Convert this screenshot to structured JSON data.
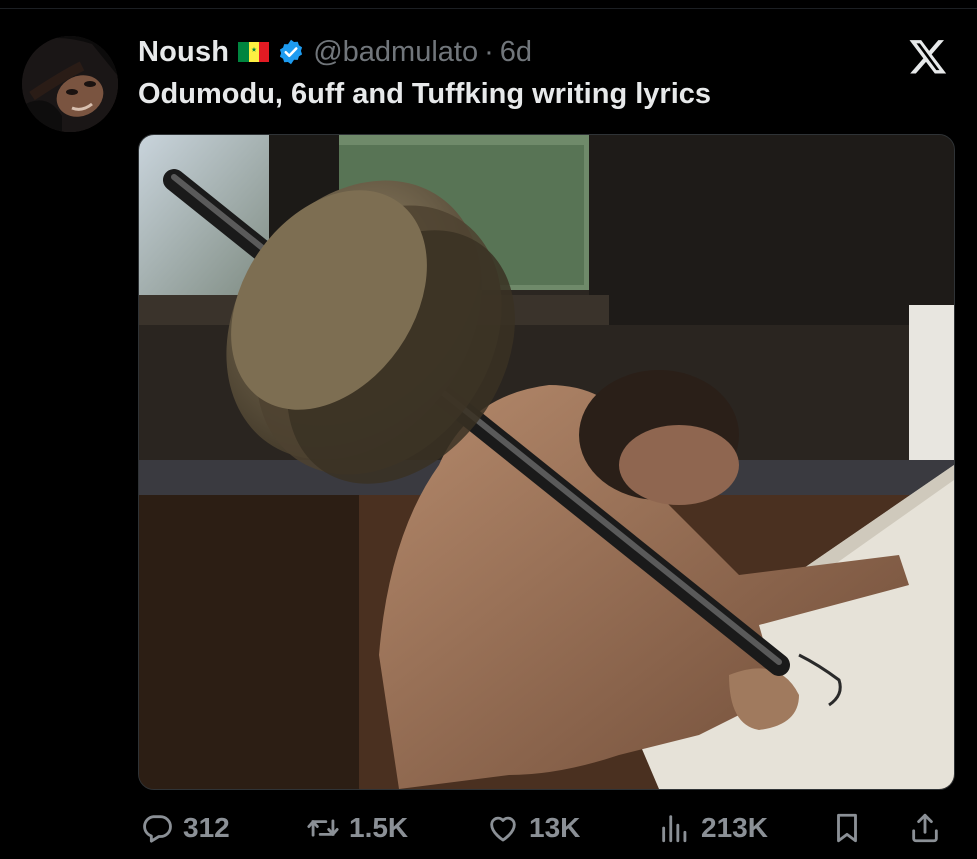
{
  "tweet": {
    "author_name": "Noush",
    "handle": "@badmulato",
    "separator": "·",
    "time": "6d",
    "text": "Odumodu, 6uff and Tuffking writing lyrics"
  },
  "colors": {
    "background": "#000000",
    "text": "#e7e9ea",
    "muted": "#71767b",
    "verified_badge": "#1d9bf0",
    "flag_green": "#00853f",
    "flag_yellow": "#fdef42",
    "flag_red": "#e31b23"
  },
  "icons": {
    "reply": "reply-icon",
    "retweet": "retweet-icon",
    "like": "heart-icon",
    "views": "bar-chart-icon",
    "bookmark": "bookmark-icon",
    "share": "share-icon",
    "logo": "x-logo-icon",
    "verified": "verified-badge-icon",
    "flag": "senegal-flag-icon"
  },
  "stats": {
    "replies": "312",
    "reposts": "1.5K",
    "likes": "13K",
    "views": "213K"
  }
}
